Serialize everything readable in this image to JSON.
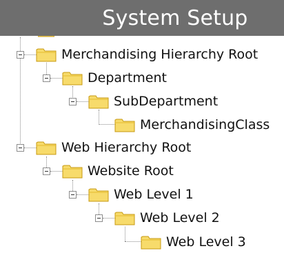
{
  "header": {
    "title": "System Setup"
  },
  "tree": {
    "nodes": [
      {
        "label": "Merchandising Hierarchy Root",
        "icon": "folder-icon",
        "expanded": true
      },
      {
        "label": "Department",
        "icon": "folder-icon",
        "expanded": true
      },
      {
        "label": "SubDepartment",
        "icon": "folder-icon",
        "expanded": true
      },
      {
        "label": "MerchandisingClass",
        "icon": "folder-icon",
        "expanded": false
      },
      {
        "label": "Web Hierarchy Root",
        "icon": "folder-icon",
        "expanded": true
      },
      {
        "label": "Website Root",
        "icon": "folder-icon",
        "expanded": true
      },
      {
        "label": "Web Level 1",
        "icon": "folder-icon",
        "expanded": true
      },
      {
        "label": "Web Level 2",
        "icon": "folder-icon",
        "expanded": true
      },
      {
        "label": "Web Level 3",
        "icon": "folder-icon",
        "expanded": false
      }
    ]
  },
  "colors": {
    "header_bg": "#6e6e6e",
    "folder_fill": "#f4d35a",
    "folder_dark": "#c79a12"
  }
}
